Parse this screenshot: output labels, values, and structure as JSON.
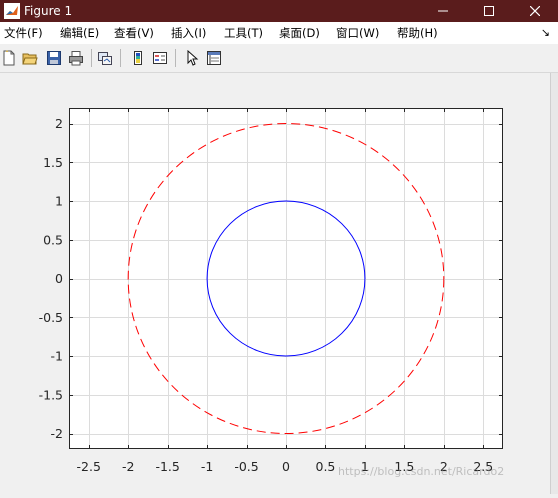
{
  "window": {
    "title": "Figure 1",
    "buttons": [
      "minimize",
      "maximize",
      "close"
    ]
  },
  "menu": {
    "items": [
      "文件(F)",
      "编辑(E)",
      "查看(V)",
      "插入(I)",
      "工具(T)",
      "桌面(D)",
      "窗口(W)",
      "帮助(H)"
    ],
    "overflow_arrow": "↘"
  },
  "toolbar": {
    "buttons": [
      "new-figure-icon",
      "open-file-icon",
      "save-icon",
      "print-icon",
      "link-plot-icon",
      "insert-colorbar-icon",
      "insert-legend-icon",
      "edit-plot-icon",
      "property-inspector-icon"
    ]
  },
  "chart_data": {
    "type": "line",
    "grid": true,
    "xlim": [
      -2.75,
      2.75
    ],
    "ylim": [
      -2.2,
      2.2
    ],
    "xticks": [
      "-2.5",
      "-2",
      "-1.5",
      "-1",
      "-0.5",
      "0",
      "0.5",
      "1",
      "1.5",
      "2",
      "2.5"
    ],
    "yticks": [
      "2",
      "1.5",
      "1",
      "0.5",
      "0",
      "-0.5",
      "-1",
      "-1.5",
      "-2"
    ],
    "series": [
      {
        "shape": "circle",
        "center": [
          0,
          0
        ],
        "radius": 1,
        "color": "#0000ff",
        "linestyle": "solid"
      },
      {
        "shape": "circle",
        "center": [
          0,
          0
        ],
        "radius": 2,
        "color": "#ff0000",
        "linestyle": "dashed"
      }
    ]
  },
  "watermark": "https://blog.csdn.net/Ricardo2"
}
